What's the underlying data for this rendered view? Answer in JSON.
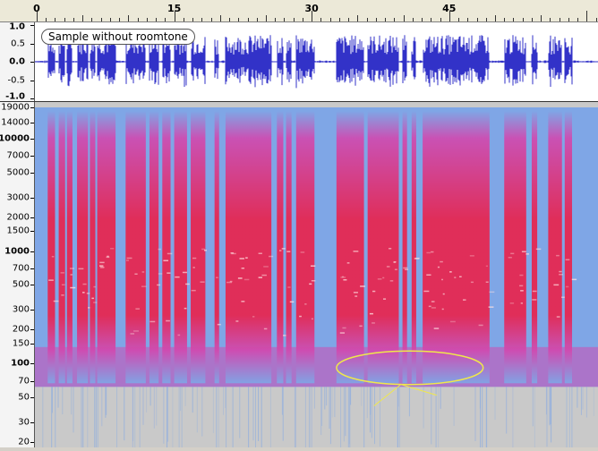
{
  "ruler": {
    "marks": [
      {
        "label": "0",
        "t": 0
      },
      {
        "label": "15",
        "t": 15
      },
      {
        "label": "30",
        "t": 30
      },
      {
        "label": "45",
        "t": 45
      }
    ]
  },
  "waveform": {
    "track_name": "Sample without roomtone",
    "axis": [
      {
        "label": "1.0",
        "value": 1.0,
        "bold": true
      },
      {
        "label": "0.5",
        "value": 0.5,
        "bold": false
      },
      {
        "label": "0.0",
        "value": 0.0,
        "bold": true
      },
      {
        "label": "-0.5",
        "value": -0.5,
        "bold": false
      },
      {
        "label": "-1.0",
        "value": -1.0,
        "bold": true
      }
    ],
    "color": "#3232c8"
  },
  "spectrogram": {
    "axis": [
      {
        "label": "19000",
        "hz": 19000,
        "bold": false
      },
      {
        "label": "14000",
        "hz": 14000,
        "bold": false
      },
      {
        "label": "10000",
        "hz": 10000,
        "bold": true
      },
      {
        "label": "7000",
        "hz": 7000,
        "bold": false
      },
      {
        "label": "5000",
        "hz": 5000,
        "bold": false
      },
      {
        "label": "3000",
        "hz": 3000,
        "bold": false
      },
      {
        "label": "2000",
        "hz": 2000,
        "bold": false
      },
      {
        "label": "1500",
        "hz": 1500,
        "bold": false
      },
      {
        "label": "1000",
        "hz": 1000,
        "bold": true
      },
      {
        "label": "700",
        "hz": 700,
        "bold": false
      },
      {
        "label": "500",
        "hz": 500,
        "bold": false
      },
      {
        "label": "300",
        "hz": 300,
        "bold": false
      },
      {
        "label": "200",
        "hz": 200,
        "bold": false
      },
      {
        "label": "150",
        "hz": 150,
        "bold": false
      },
      {
        "label": "100",
        "hz": 100,
        "bold": true
      },
      {
        "label": "70",
        "hz": 70,
        "bold": false
      },
      {
        "label": "50",
        "hz": 50,
        "bold": false
      },
      {
        "label": "30",
        "hz": 30,
        "bold": false
      },
      {
        "label": "20",
        "hz": 20,
        "bold": false
      }
    ],
    "colors": {
      "background": "#c9c9c9",
      "low": "#7fa6e6",
      "mid": "#d04ab0",
      "high": "#e8234d",
      "peak": "#ffe0e0"
    },
    "annotation": {
      "shape": "ellipse",
      "color": "#f0e84a",
      "t_start": 32.7,
      "t_end": 48.7,
      "hz_low": 70,
      "hz_high": 120
    }
  },
  "speech_segments": [
    [
      1.2,
      2.0
    ],
    [
      2.4,
      3.1
    ],
    [
      3.3,
      3.9
    ],
    [
      4.4,
      5.6
    ],
    [
      5.8,
      6.4
    ],
    [
      6.6,
      8.6
    ],
    [
      9.7,
      11.9
    ],
    [
      12.3,
      13.3
    ],
    [
      13.7,
      14.6
    ],
    [
      15.0,
      16.4
    ],
    [
      16.8,
      18.4
    ],
    [
      19.4,
      19.9
    ],
    [
      20.6,
      25.6
    ],
    [
      26.2,
      26.9
    ],
    [
      27.2,
      27.8
    ],
    [
      28.3,
      30.3
    ],
    [
      32.7,
      35.7
    ],
    [
      36.1,
      39.5
    ],
    [
      39.9,
      40.4
    ],
    [
      40.9,
      41.4
    ],
    [
      42.1,
      49.4
    ],
    [
      51.0,
      53.4
    ],
    [
      54.0,
      54.6
    ],
    [
      55.8,
      57.3
    ],
    [
      57.6,
      58.4
    ]
  ]
}
